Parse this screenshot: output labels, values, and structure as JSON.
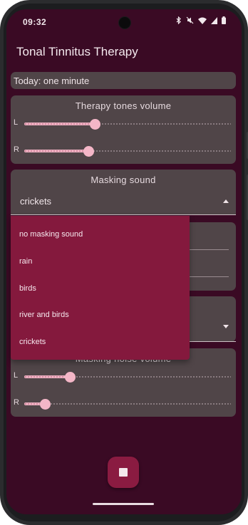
{
  "status_bar": {
    "time": "09:32"
  },
  "app": {
    "title": "Tonal Tinnitus Therapy"
  },
  "today": {
    "text": "Today: one minute"
  },
  "therapy_volume": {
    "title": "Therapy tones volume",
    "left": {
      "label": "L",
      "value_fraction": 0.34
    },
    "right": {
      "label": "R",
      "value_fraction": 0.31
    }
  },
  "masking_sound": {
    "title": "Masking sound",
    "selected": "crickets",
    "options": [
      "no masking sound",
      "rain",
      "birds",
      "river and birds",
      "crickets"
    ]
  },
  "masking_noise_volume": {
    "title": "Masking noise volume",
    "left": {
      "label": "L",
      "value_fraction": 0.22
    },
    "right": {
      "label": "R",
      "value_fraction": 0.1
    }
  },
  "colors": {
    "background": "#3a0a24",
    "card": "#504548",
    "accent": "#f4b6c7",
    "menu": "#84193d",
    "fab": "#8a1b41"
  },
  "icons": {
    "status": [
      "bluetooth-icon",
      "mute-icon",
      "wifi-icon",
      "signal-icon",
      "battery-icon"
    ],
    "fab": "stop-icon"
  }
}
